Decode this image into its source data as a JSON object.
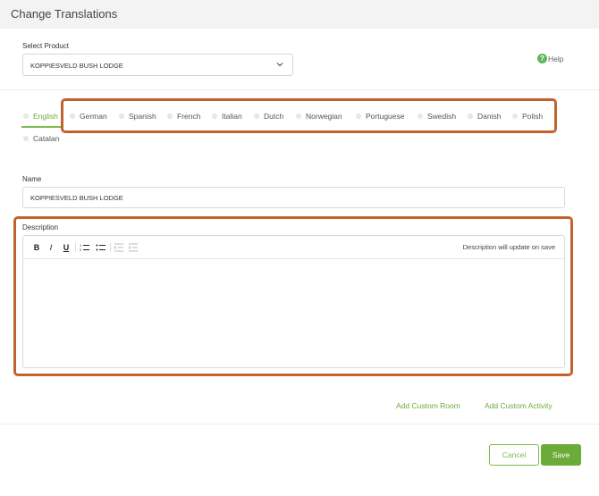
{
  "header": {
    "title": "Change Translations"
  },
  "product": {
    "label": "Select Product",
    "selected": "KOPPIESVELD BUSH LODGE"
  },
  "help": {
    "label": "Help"
  },
  "languages": [
    {
      "label": "English",
      "active": true
    },
    {
      "label": "German"
    },
    {
      "label": "Spanish"
    },
    {
      "label": "French"
    },
    {
      "label": "Italian"
    },
    {
      "label": "Dutch"
    },
    {
      "label": "Norwegian"
    },
    {
      "label": "Portuguese"
    },
    {
      "label": "Swedish"
    },
    {
      "label": "Danish"
    },
    {
      "label": "Polish"
    },
    {
      "label": "Catalan"
    }
  ],
  "name_field": {
    "label": "Name",
    "value": "KOPPIESVELD BUSH LODGE"
  },
  "description": {
    "label": "Description",
    "note": "Description will update on save",
    "toolbar": [
      "B",
      "I",
      "U"
    ]
  },
  "links": {
    "add_room": "Add Custom Room",
    "add_activity": "Add Custom Activity"
  },
  "actions": {
    "cancel": "Cancel",
    "save": "Save"
  },
  "colors": {
    "accent": "#6aab3a",
    "highlight": "#c2632e"
  }
}
